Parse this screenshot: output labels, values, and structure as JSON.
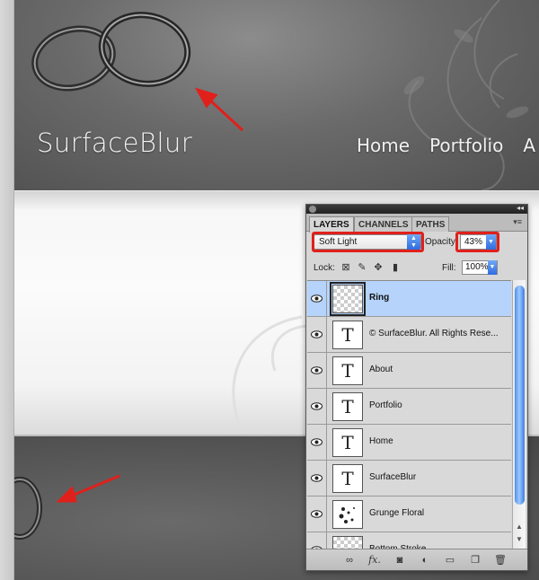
{
  "site": {
    "logo": "SurfaceBlur",
    "nav": [
      "Home",
      "Portfolio",
      "A"
    ]
  },
  "panel": {
    "tabs": [
      {
        "label": "LAYERS",
        "active": true
      },
      {
        "label": "CHANNELS",
        "active": false
      },
      {
        "label": "PATHS",
        "active": false
      }
    ],
    "blend_mode": "Soft Light",
    "opacity_label": "Opacity:",
    "opacity_value": "43%",
    "lock_label": "Lock:",
    "fill_label": "Fill:",
    "fill_value": "100%",
    "layers": [
      {
        "name": "Ring",
        "kind": "raster",
        "selected": true
      },
      {
        "name": "© SurfaceBlur.  All Rights Rese...",
        "kind": "text",
        "selected": false
      },
      {
        "name": "About",
        "kind": "text",
        "selected": false
      },
      {
        "name": "Portfolio",
        "kind": "text",
        "selected": false
      },
      {
        "name": "Home",
        "kind": "text",
        "selected": false
      },
      {
        "name": "SurfaceBlur",
        "kind": "text",
        "selected": false
      },
      {
        "name": "Grunge Floral",
        "kind": "floral",
        "selected": false
      },
      {
        "name": "Bottom Stroke",
        "kind": "raster",
        "selected": false
      }
    ],
    "text_thumb_glyph": "T",
    "bottom_icons": [
      "link-icon",
      "fx-icon",
      "mask-icon",
      "adjustment-icon",
      "folder-icon",
      "new-layer-icon",
      "trash-icon"
    ],
    "fx_label": "fx."
  },
  "colors": {
    "highlight_red": "#e0201b",
    "selection_blue": "#b5d3fb"
  }
}
